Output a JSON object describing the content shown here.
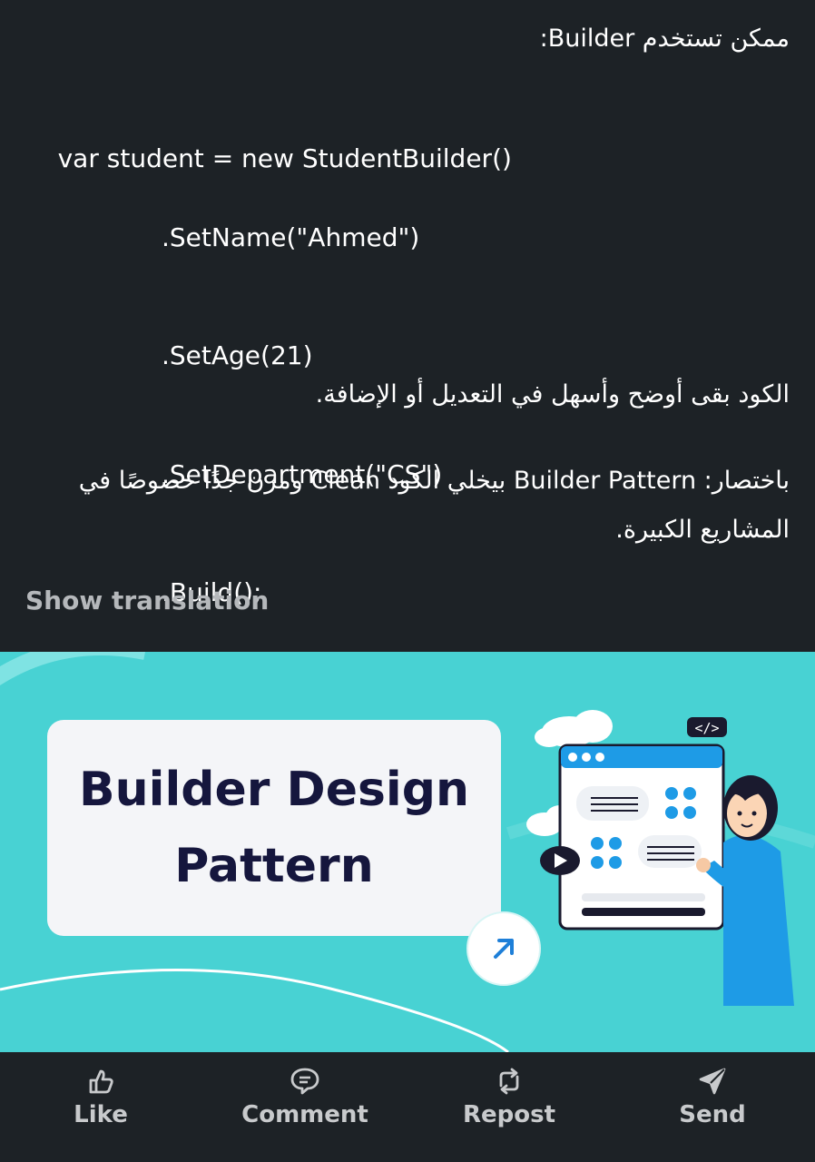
{
  "post": {
    "intro_line": "ممكن تستخدم Builder:",
    "code_lines": [
      "var student = new StudentBuilder()",
      ".SetName(\"Ahmed\")",
      ".SetAge(21)",
      ".SetDepartment(\"CS\")",
      ".Build();"
    ],
    "paragraph_1": "الكود بقى أوضح وأسهل في التعديل أو الإضافة.",
    "paragraph_2": "باختصار: Builder Pattern بيخلي الكود Clean ومرن جدًا خصوصًا في المشاريع الكبيرة.",
    "show_translation": "Show translation"
  },
  "media": {
    "title_line_1": "Builder Design",
    "title_line_2": "Pattern",
    "code_tag": "</>",
    "background_color": "#48d2d3"
  },
  "actions": [
    {
      "label": "Like",
      "icon": "like-icon"
    },
    {
      "label": "Comment",
      "icon": "comment-icon"
    },
    {
      "label": "Repost",
      "icon": "repost-icon"
    },
    {
      "label": "Send",
      "icon": "send-icon"
    }
  ]
}
